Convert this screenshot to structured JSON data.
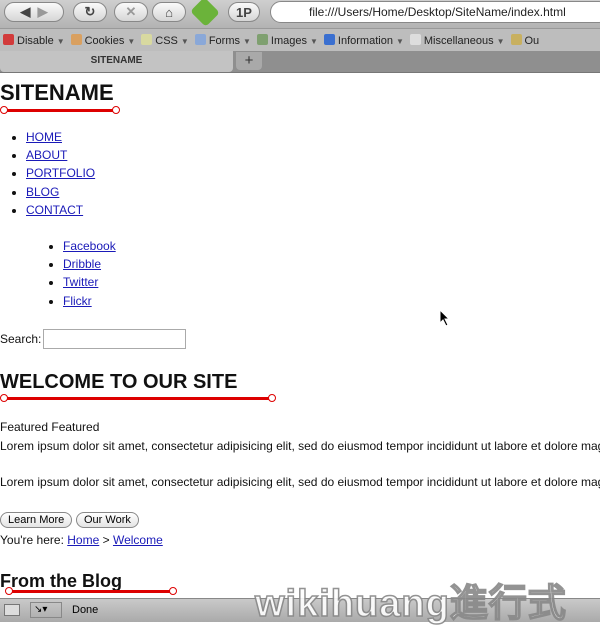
{
  "browser": {
    "url": "file:///Users/Home/Desktop/SiteName/index.html",
    "onepassword_label": "1P",
    "bookmarks": [
      {
        "label": "Disable",
        "color": "#d23b3b"
      },
      {
        "label": "Cookies",
        "color": "#d9a060"
      },
      {
        "label": "CSS",
        "color": "#d8d9a0"
      },
      {
        "label": "Forms",
        "color": "#8aa8d8"
      },
      {
        "label": "Images",
        "color": "#7fa070"
      },
      {
        "label": "Information",
        "color": "#3a6fd0"
      },
      {
        "label": "Miscellaneous",
        "color": "#dddddd"
      },
      {
        "label": "Ou",
        "color": "#c8b060"
      }
    ],
    "tab_title": "SITENAME",
    "new_tab": "+",
    "status": "Done"
  },
  "page": {
    "site_name": "SITENAME",
    "nav": [
      "HOME",
      "ABOUT",
      "PORTFOLIO",
      "BLOG",
      "CONTACT"
    ],
    "social": [
      "Facebook",
      "Dribble",
      "Twitter",
      "Flickr"
    ],
    "search_label": "Search:",
    "search_value": "",
    "welcome_heading": "WELCOME TO OUR SITE",
    "featured": "Featured Featured",
    "para1": "Lorem ipsum dolor sit amet, consectetur adipisicing elit, sed do eiusmod tempor incididunt ut labore et dolore magna aliqua.",
    "para2": "Lorem ipsum dolor sit amet, consectetur adipisicing elit, sed do eiusmod tempor incididunt ut labore et dolore magna aliqua.",
    "learn_more": "Learn More",
    "our_work": "Our Work",
    "breadcrumb": {
      "prefix": "You're here:",
      "home": "Home",
      "sep": ">",
      "current": "Welcome"
    },
    "blog_heading": "From the Blog",
    "accent_color": "#dd0000"
  },
  "watermark": "wikihuang進行式"
}
